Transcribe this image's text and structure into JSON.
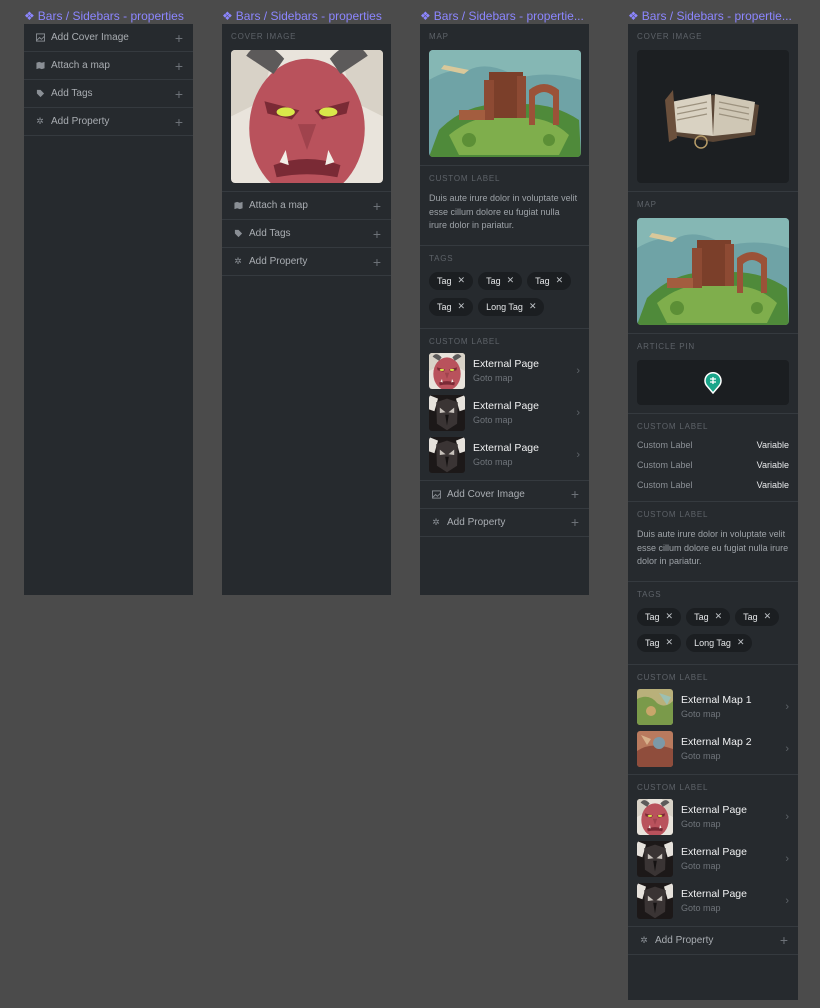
{
  "frames": [
    {
      "title": "Bars / Sidebars - properties"
    },
    {
      "title": "Bars / Sidebars - properties"
    },
    {
      "title": "Bars / Sidebars - propertie..."
    },
    {
      "title": "Bars / Sidebars - propertie..."
    }
  ],
  "panel1": {
    "rows": [
      {
        "label": "Add Cover Image",
        "icon": "image-icon"
      },
      {
        "label": "Attach a map",
        "icon": "map-icon"
      },
      {
        "label": "Add Tags",
        "icon": "tag-icon"
      },
      {
        "label": "Add Property",
        "icon": "gear-icon"
      }
    ]
  },
  "panel2": {
    "cover_title": "COVER IMAGE",
    "rows": [
      {
        "label": "Attach a map",
        "icon": "map-icon"
      },
      {
        "label": "Add Tags",
        "icon": "tag-icon"
      },
      {
        "label": "Add Property",
        "icon": "gear-icon"
      }
    ]
  },
  "panel3": {
    "map_title": "MAP",
    "custom_label_title": "CUSTOM LABEL",
    "paragraph": "Duis aute irure dolor in voluptate velit esse cillum dolore eu fugiat nulla irure dolor in pariatur.",
    "tags_title": "TAGS",
    "tags": [
      "Tag",
      "Tag",
      "Tag",
      "Tag",
      "Long Tag"
    ],
    "links_title": "CUSTOM LABEL",
    "links": [
      {
        "title": "External Page",
        "sub": "Goto map",
        "thumb": "red-demon"
      },
      {
        "title": "External Page",
        "sub": "Goto map",
        "thumb": "dark-demon"
      },
      {
        "title": "External Page",
        "sub": "Goto map",
        "thumb": "dark-demon"
      }
    ],
    "rows": [
      {
        "label": "Add Cover Image",
        "icon": "image-icon"
      },
      {
        "label": "Add Property",
        "icon": "gear-icon"
      }
    ]
  },
  "panel4": {
    "cover_title": "COVER IMAGE",
    "map_title": "MAP",
    "pin_title": "ARTICLE PIN",
    "kv_title": "CUSTOM LABEL",
    "kv": [
      {
        "key": "Custom Label",
        "value": "Variable"
      },
      {
        "key": "Custom Label",
        "value": "Variable"
      },
      {
        "key": "Custom Label",
        "value": "Variable"
      }
    ],
    "para_title": "CUSTOM LABEL",
    "paragraph": "Duis aute irure dolor in voluptate velit esse cillum dolore eu fugiat nulla irure dolor in pariatur.",
    "tags_title": "TAGS",
    "tags": [
      "Tag",
      "Tag",
      "Tag",
      "Tag",
      "Long Tag"
    ],
    "maps_title": "CUSTOM LABEL",
    "maps": [
      {
        "title": "External Map 1",
        "sub": "Goto map",
        "thumb": "map-green"
      },
      {
        "title": "External Map 2",
        "sub": "Goto map",
        "thumb": "map-red"
      }
    ],
    "links_title": "CUSTOM LABEL",
    "links": [
      {
        "title": "External Page",
        "sub": "Goto map",
        "thumb": "red-demon"
      },
      {
        "title": "External Page",
        "sub": "Goto map",
        "thumb": "dark-demon"
      },
      {
        "title": "External Page",
        "sub": "Goto map",
        "thumb": "dark-demon"
      }
    ],
    "rows": [
      {
        "label": "Add Property",
        "icon": "gear-icon"
      }
    ]
  },
  "colors": {
    "accent": "#8c86ff",
    "panel": "#262a2e",
    "pin": "#1aa58a"
  }
}
